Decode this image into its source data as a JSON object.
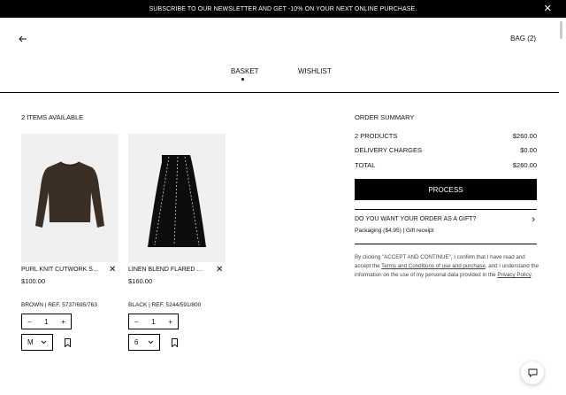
{
  "promo": {
    "text": "SUBSCRIBE TO OUR NEWSLETTER AND GET -10% ON YOUR NEXT ONLINE PURCHASE.",
    "close_icon": "close-icon"
  },
  "header": {
    "back_icon": "arrow-left-icon",
    "bag_label": "BAG (2)"
  },
  "tabs": [
    {
      "label": "BASKET",
      "active": true
    },
    {
      "label": "WISHLIST",
      "active": false
    }
  ],
  "basket": {
    "items_available": "2 ITEMS AVAILABLE",
    "products": [
      {
        "name": "PURL KNIT CUTWORK SW...",
        "price": "$100.00",
        "ref": "BROWN | REF. 5737/695/763",
        "quantity": "1",
        "size": "M",
        "color": "#3b2e25"
      },
      {
        "name": "LINEN BLEND FLARED MID...",
        "price": "$160.00",
        "ref": "BLACK | REF. 5244/591/800",
        "quantity": "1",
        "size": "6",
        "color": "#0d0d0d"
      }
    ],
    "minus": "−",
    "plus": "+"
  },
  "summary": {
    "title": "ORDER SUMMARY",
    "products_label": "2 PRODUCTS",
    "products_value": "$260.00",
    "delivery_label": "DELIVERY CHARGES",
    "delivery_value": "$0.00",
    "total_label": "TOTAL",
    "total_value": "$260.00",
    "process_label": "PROCESS",
    "gift_question": "DO YOU WANT YOUR ORDER AS A GIFT?",
    "gift_sub": "Packaging ($4.95) | Gift receipt",
    "legal_1": "By clicking \"ACCEPT AND CONTINUE\", I confirm that I have read and accept the ",
    "legal_link_1": "Terms and Conditions of use and purchase",
    "legal_2": ", and I understand the information on the use of my personal data provided in the ",
    "legal_link_2": "Privacy Policy",
    "legal_3": "."
  },
  "chat_icon": "chat-bubble-icon"
}
